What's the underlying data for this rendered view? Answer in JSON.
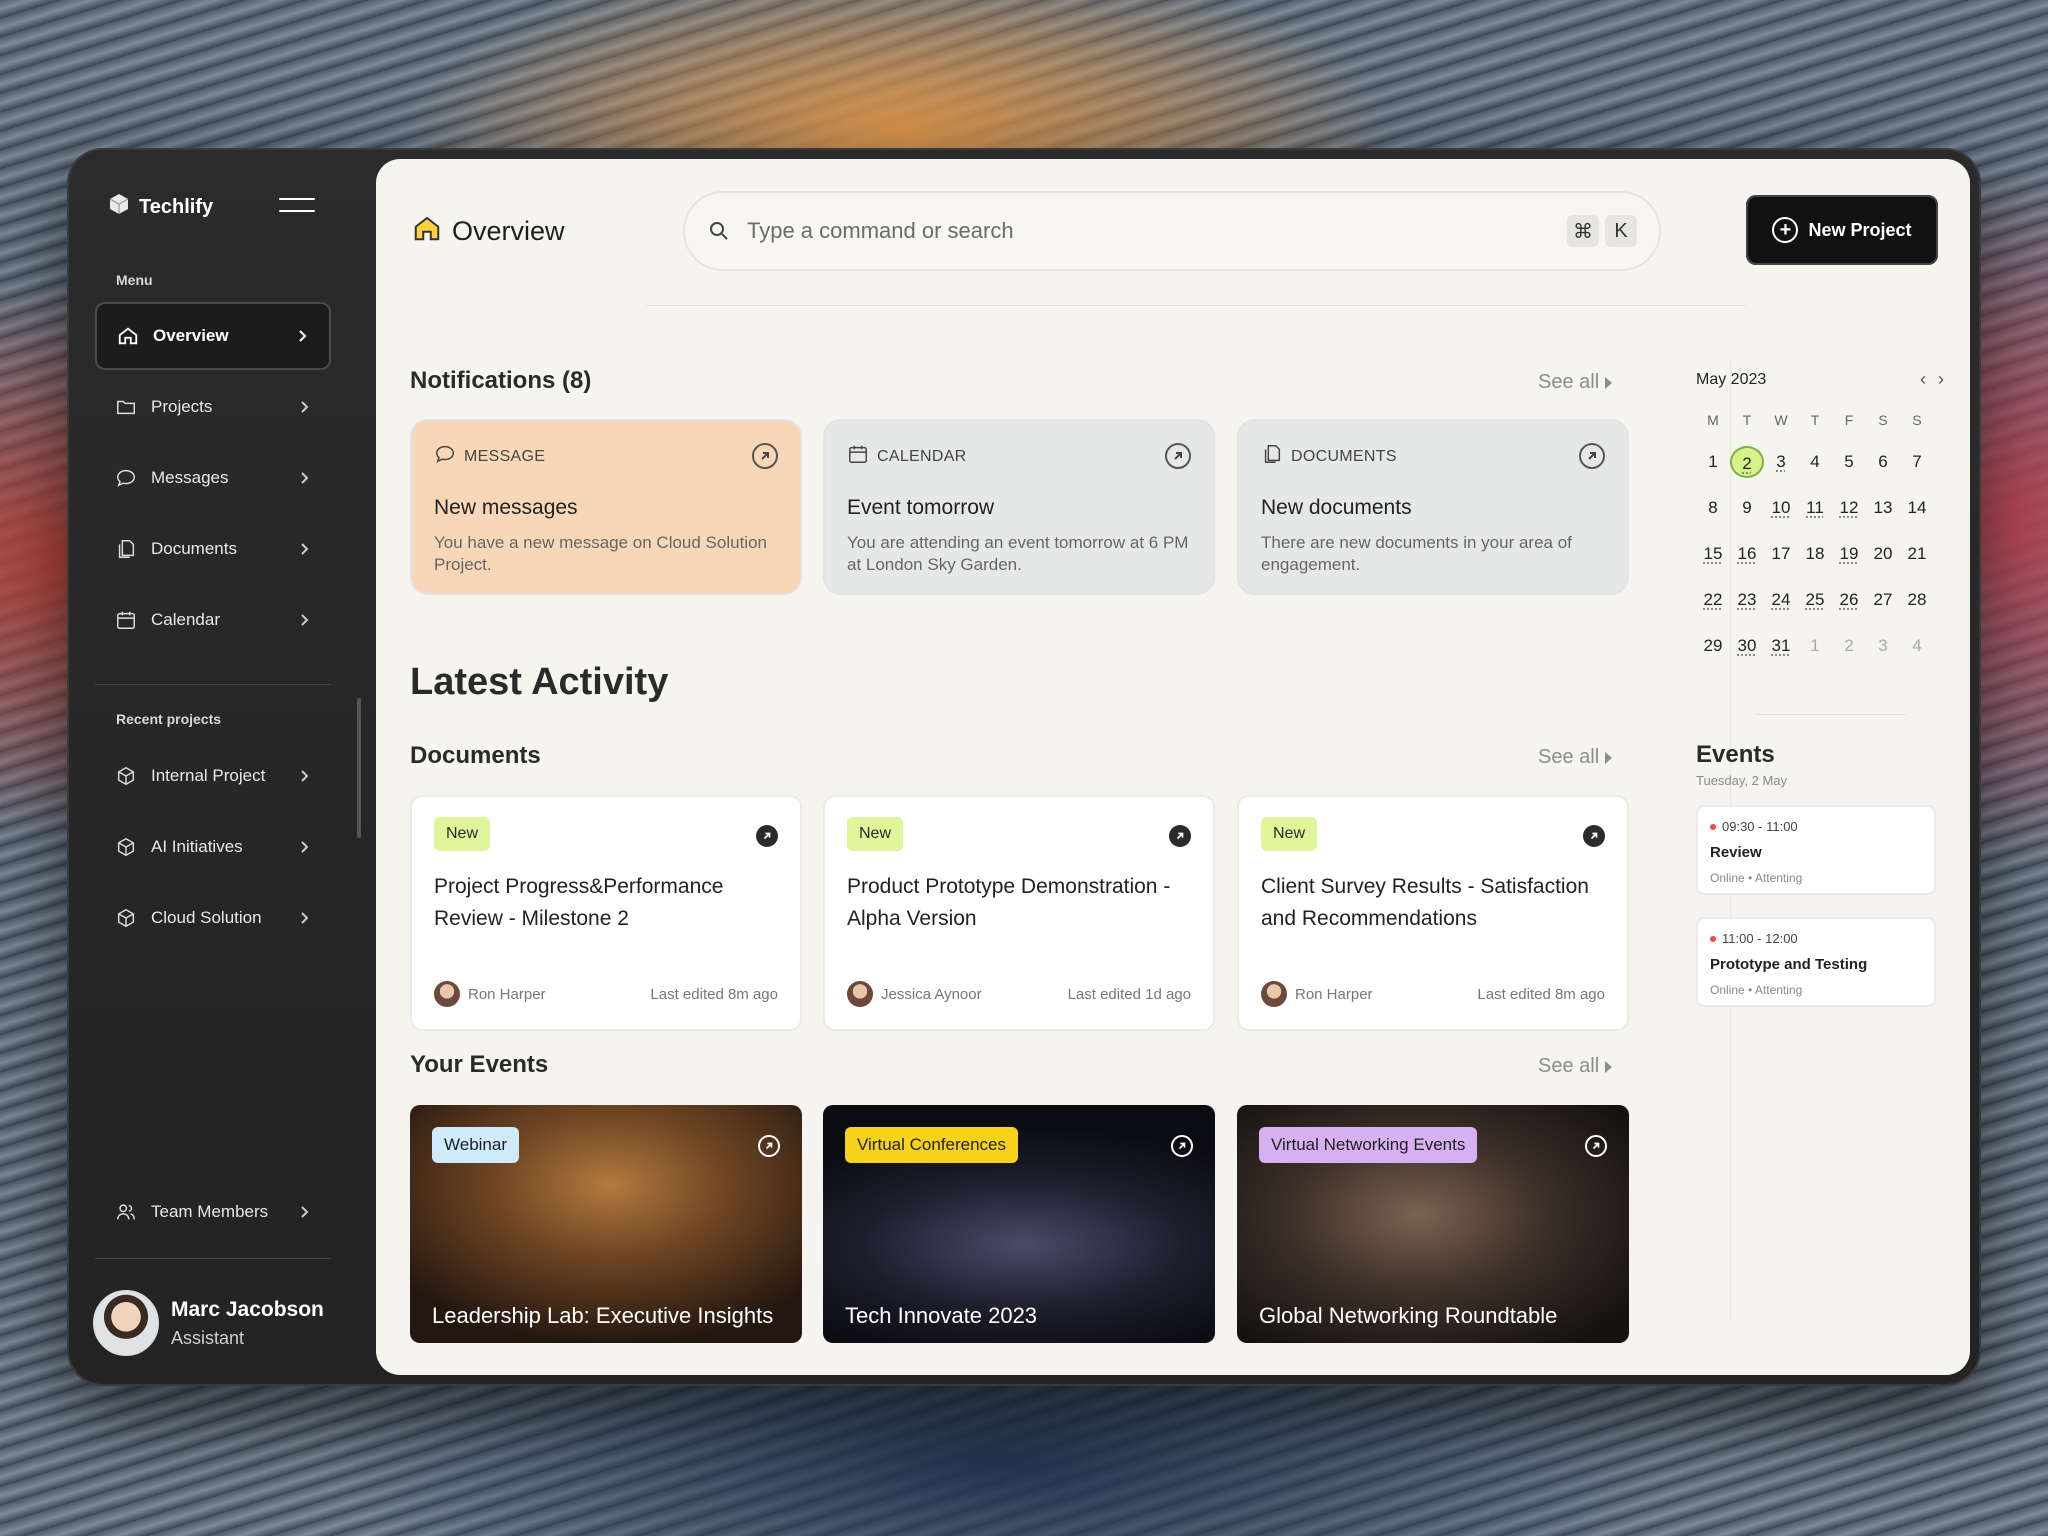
{
  "brand": {
    "name": "Techlify"
  },
  "sidebar": {
    "menu_label": "Menu",
    "items": [
      {
        "label": "Overview",
        "icon": "home-icon",
        "active": true
      },
      {
        "label": "Projects",
        "icon": "folder-icon"
      },
      {
        "label": "Messages",
        "icon": "chat-icon"
      },
      {
        "label": "Documents",
        "icon": "documents-icon"
      },
      {
        "label": "Calendar",
        "icon": "calendar-icon"
      }
    ],
    "recent_label": "Recent projects",
    "recent": [
      {
        "label": "Internal Project",
        "icon": "cube-icon"
      },
      {
        "label": "AI Initiatives",
        "icon": "cube-icon"
      },
      {
        "label": "Cloud Solution",
        "icon": "cube-icon"
      }
    ],
    "team_label": "Team Members",
    "user": {
      "name": "Marc Jacobson",
      "role": "Assistant"
    }
  },
  "header": {
    "title": "Overview",
    "search_placeholder": "Type a command or search",
    "shortcut": [
      "⌘",
      "K"
    ],
    "new_project": "New Project"
  },
  "notifications": {
    "title": "Notifications (8)",
    "see_all": "See all",
    "cards": [
      {
        "type": "MESSAGE",
        "title": "New messages",
        "text": "You have a new message on Cloud Solution Project.",
        "color": "#f7d7b8"
      },
      {
        "type": "CALENDAR",
        "title": "Event tomorrow",
        "text": "You are attending an event tomorrow at 6 PM at London Sky Garden.",
        "color": "#e6e8e8"
      },
      {
        "type": "DOCUMENTS",
        "title": "New documents",
        "text": "There are new documents in your area of engagement.",
        "color": "#e6e8e8"
      }
    ]
  },
  "latest_activity": "Latest Activity",
  "documents": {
    "title": "Documents",
    "see_all": "See all",
    "cards": [
      {
        "badge": "New",
        "title": "Project Progress&Performance Review - Milestone 2",
        "author": "Ron Harper",
        "edited": "Last edited 8m ago"
      },
      {
        "badge": "New",
        "title": "Product Prototype Demonstration - Alpha Version",
        "author": "Jessica Aynoor",
        "edited": "Last edited 1d ago"
      },
      {
        "badge": "New",
        "title": "Client Survey Results - Satisfaction and Recommendations",
        "author": "Ron Harper",
        "edited": "Last edited 8m ago"
      }
    ]
  },
  "your_events": {
    "title": "Your Events",
    "see_all": "See all",
    "cards": [
      {
        "tag": "Webinar",
        "tag_color": "#cfeafa",
        "title": "Leadership Lab: Executive Insights"
      },
      {
        "tag": "Virtual Conferences",
        "tag_color": "#f6d21a",
        "title": "Tech Innovate 2023"
      },
      {
        "tag": "Virtual Networking Events",
        "tag_color": "#d7b0f2",
        "title": "Global Networking Roundtable"
      }
    ]
  },
  "calendar": {
    "month": "May 2023",
    "weekdays": [
      "M",
      "T",
      "W",
      "T",
      "F",
      "S",
      "S"
    ],
    "selected": 2,
    "days": [
      "1",
      "2",
      "3",
      "4",
      "5",
      "6",
      "7",
      "8",
      "9",
      "10",
      "11",
      "12",
      "13",
      "14",
      "15",
      "16",
      "17",
      "18",
      "19",
      "20",
      "21",
      "22",
      "23",
      "24",
      "25",
      "26",
      "27",
      "28",
      "29",
      "30",
      "31",
      "1",
      "2",
      "3",
      "4"
    ],
    "dotted": [
      2,
      3,
      10,
      11,
      12,
      15,
      16,
      19,
      22,
      23,
      24,
      25,
      26,
      30,
      31
    ]
  },
  "events_panel": {
    "title": "Events",
    "date": "Tuesday, 2 May",
    "items": [
      {
        "time": "09:30 - 11:00",
        "name": "Review",
        "meta": "Online • Attenting"
      },
      {
        "time": "11:00 - 12:00",
        "name": "Prototype and Testing",
        "meta": "Online • Attenting"
      }
    ]
  }
}
